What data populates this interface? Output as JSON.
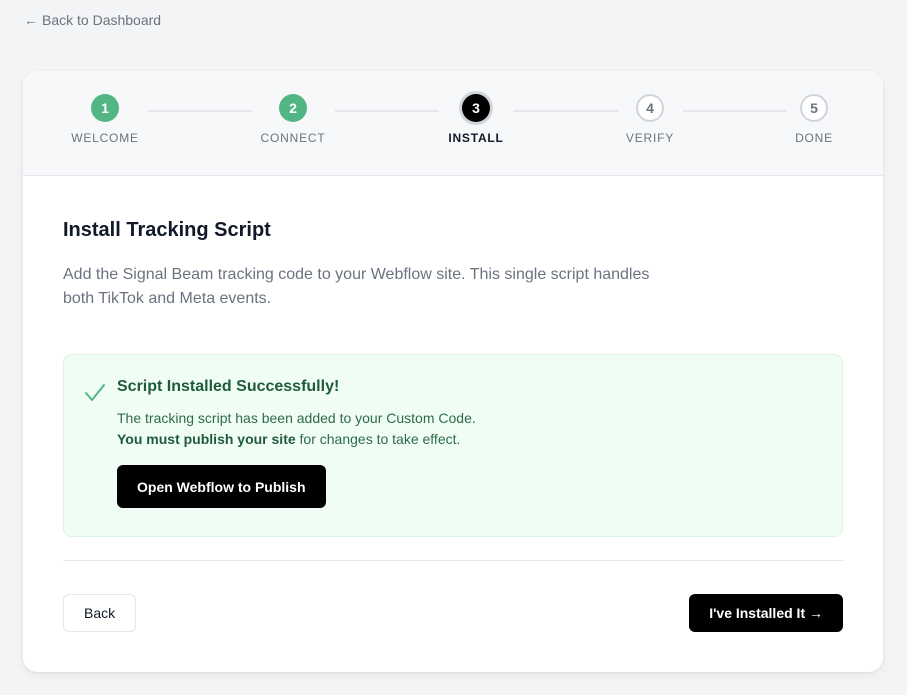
{
  "nav": {
    "back_label": "Back to Dashboard",
    "back_icon": "arrow-left-icon"
  },
  "stepper": {
    "steps": [
      {
        "number": "1",
        "label": "WELCOME",
        "state": "done"
      },
      {
        "number": "2",
        "label": "CONNECT",
        "state": "done"
      },
      {
        "number": "3",
        "label": "INSTALL",
        "state": "active"
      },
      {
        "number": "4",
        "label": "VERIFY",
        "state": "todo"
      },
      {
        "number": "5",
        "label": "DONE",
        "state": "todo"
      }
    ]
  },
  "main": {
    "title": "Install Tracking Script",
    "description": "Add the Signal Beam tracking code to your Webflow site. This single script handles both TikTok and Meta events."
  },
  "success": {
    "icon": "checkmark-icon",
    "title": "Script Installed Successfully!",
    "line1": "The tracking script has been added to your Custom Code.",
    "line2_bold": "You must publish your site",
    "line2_rest": " for changes to take effect.",
    "button_label": "Open Webflow to Publish"
  },
  "footer": {
    "back_label": "Back",
    "next_label": "I've Installed It →"
  },
  "colors": {
    "step_done": "#52b684",
    "step_active": "#000000",
    "success_bg": "#f0fdf4",
    "success_text": "#1f5b3a",
    "page_bg": "#f3f4f6"
  }
}
